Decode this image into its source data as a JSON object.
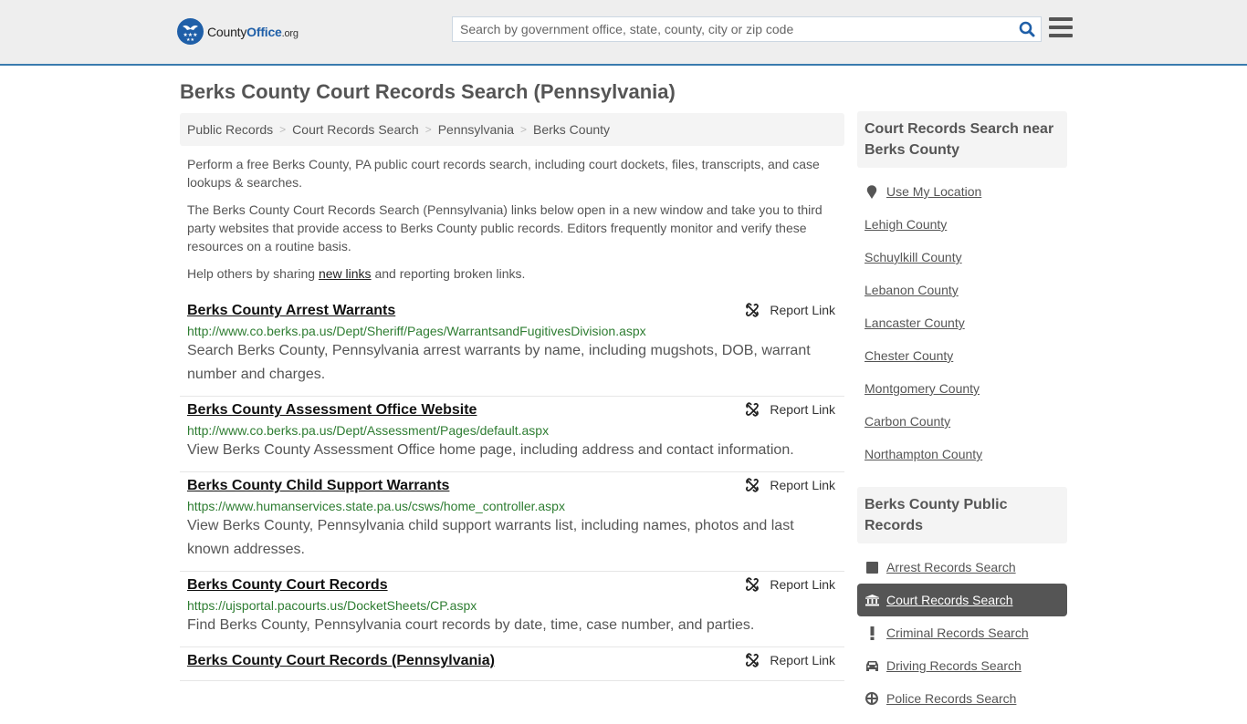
{
  "header": {
    "logo_county": "County",
    "logo_office": "Office",
    "logo_org": ".org",
    "search_placeholder": "Search by government office, state, county, city or zip code",
    "brand_color": "#1f5fa8",
    "accent_border": "#3a7bae"
  },
  "page": {
    "title": "Berks County Court Records Search (Pennsylvania)"
  },
  "breadcrumb": [
    "Public Records",
    "Court Records Search",
    "Pennsylvania",
    "Berks County"
  ],
  "intro": {
    "p1": "Perform a free Berks County, PA public court records search, including court dockets, files, transcripts, and case lookups & searches.",
    "p2": "The Berks County Court Records Search (Pennsylvania) links below open in a new window and take you to third party websites that provide access to Berks County public records. Editors frequently monitor and verify these resources on a routine basis.",
    "p3_before": "Help others by sharing ",
    "p3_link": "new links",
    "p3_after": " and reporting broken links."
  },
  "report_label": "Report Link",
  "results": [
    {
      "title": "Berks County Arrest Warrants",
      "url": "http://www.co.berks.pa.us/Dept/Sheriff/Pages/WarrantsandFugitivesDivision.aspx",
      "desc": "Search Berks County, Pennsylvania arrest warrants by name, including mugshots, DOB, warrant number and charges."
    },
    {
      "title": "Berks County Assessment Office Website",
      "url": "http://www.co.berks.pa.us/Dept/Assessment/Pages/default.aspx",
      "desc": "View Berks County Assessment Office home page, including address and contact information."
    },
    {
      "title": "Berks County Child Support Warrants",
      "url": "https://www.humanservices.state.pa.us/csws/home_controller.aspx",
      "desc": "View Berks County, Pennsylvania child support warrants list, including names, photos and last known addresses."
    },
    {
      "title": "Berks County Court Records",
      "url": "https://ujsportal.pacourts.us/DocketSheets/CP.aspx",
      "desc": "Find Berks County, Pennsylvania court records by date, time, case number, and parties."
    },
    {
      "title": "Berks County Court Records (Pennsylvania)",
      "url": "",
      "desc": ""
    }
  ],
  "sidebar": {
    "nearby_title": "Court Records Search near Berks County",
    "use_location": "Use My Location",
    "nearby": [
      "Lehigh County",
      "Schuylkill County",
      "Lebanon County",
      "Lancaster County",
      "Chester County",
      "Montgomery County",
      "Carbon County",
      "Northampton County"
    ],
    "public_title": "Berks County Public Records",
    "public": [
      {
        "label": "Arrest Records Search",
        "icon": "square-icon"
      },
      {
        "label": "Court Records Search",
        "icon": "courthouse-icon",
        "active": true
      },
      {
        "label": "Criminal Records Search",
        "icon": "exclamation-icon"
      },
      {
        "label": "Driving Records Search",
        "icon": "car-icon"
      },
      {
        "label": "Police Records Search",
        "icon": "police-icon"
      }
    ]
  }
}
